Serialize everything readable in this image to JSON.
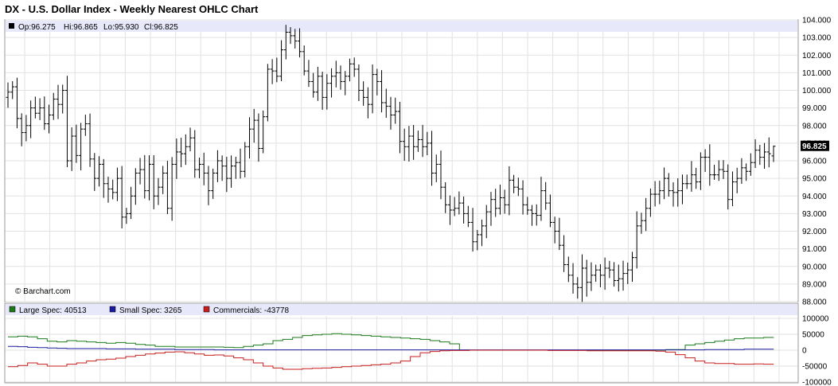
{
  "title": "DX - U.S. Dollar Index - Weekly Nearest OHLC Chart",
  "copyright": "© Barchart.com",
  "colors": {
    "header_band": "#e8e8fb",
    "grid": "#e2e2e2",
    "price": "#000000",
    "large_spec": "#1a7a1a",
    "small_spec": "#1a1aa0",
    "commercials": "#c81e1e",
    "last_box": "#000000"
  },
  "chart_data": [
    {
      "type": "ohlc",
      "header": {
        "open": "Op:96.275",
        "high": "Hi:96.865",
        "low": "Lo:95.930",
        "close": "Cl:96.825"
      },
      "last_value_label": "96.825",
      "ylim": [
        88,
        104
      ],
      "yticks": [
        "88.000",
        "89.000",
        "90.000",
        "91.000",
        "92.000",
        "93.000",
        "94.000",
        "95.000",
        "96.000",
        "97.000",
        "98.000",
        "99.000",
        "100.000",
        "101.000",
        "102.000",
        "103.000",
        "104.000"
      ],
      "grid": true,
      "last": {
        "open": 96.275,
        "high": 96.865,
        "low": 95.93,
        "close": 96.825
      },
      "closes": [
        99.9,
        100.2,
        98.4,
        97.6,
        98.0,
        99.0,
        98.7,
        99.0,
        98.1,
        98.6,
        99.5,
        99.2,
        100.0,
        96.0,
        97.4,
        96.3,
        97.8,
        98.1,
        96.1,
        95.0,
        95.8,
        94.7,
        94.4,
        94.2,
        95.0,
        92.8,
        93.0,
        94.0,
        95.3,
        95.5,
        94.3,
        95.8,
        94.0,
        94.5,
        95.3,
        93.3,
        95.8,
        96.5,
        96.4,
        96.8,
        97.3,
        95.5,
        95.8,
        95.3,
        94.3,
        95.3,
        96.0,
        95.7,
        95.0,
        95.7,
        95.9,
        95.4,
        96.8,
        97.8,
        98.3,
        96.7,
        98.5,
        101.2,
        101.1,
        100.8,
        102.3,
        103.3,
        103.1,
        102.8,
        102.2,
        101.1,
        100.5,
        99.9,
        100.8,
        99.6,
        100.4,
        100.8,
        101.0,
        100.5,
        100.8,
        101.5,
        101.2,
        100.0,
        99.6,
        99.2,
        100.9,
        100.5,
        99.3,
        99.1,
        98.6,
        98.8,
        97.1,
        96.8,
        97.4,
        96.8,
        97.2,
        96.8,
        97.0,
        95.3,
        95.8,
        94.5,
        93.5,
        93.2,
        93.3,
        93.6,
        93.0,
        92.5,
        91.4,
        91.8,
        92.3,
        93.1,
        93.8,
        93.3,
        93.9,
        93.5,
        94.9,
        94.5,
        94.4,
        93.5,
        93.2,
        93.0,
        92.9,
        94.3,
        93.6,
        92.5,
        92.0,
        91.2,
        90.1,
        89.5,
        89.0,
        88.8,
        89.9,
        89.1,
        89.5,
        89.8,
        89.5,
        89.9,
        89.8,
        89.2,
        89.3,
        89.6,
        89.8,
        90.5,
        92.3,
        92.6,
        93.3,
        94.1,
        94.1,
        94.3,
        95.0,
        94.3,
        94.2,
        94.3,
        94.7,
        94.7,
        95.2,
        94.8,
        96.2,
        96.2,
        95.2,
        95.2,
        95.5,
        95.4,
        93.8,
        94.8,
        95.0,
        95.6,
        95.4,
        95.9,
        96.6,
        96.2,
        96.5,
        96.4,
        96.8
      ]
    },
    {
      "type": "line",
      "panel": "commitments-of-traders",
      "ylim": [
        -100000,
        100000
      ],
      "yticks": [
        "-100000",
        "-50000",
        "0",
        "50000",
        "100000"
      ],
      "grid": true,
      "series": [
        {
          "name": "Large Spec",
          "legend_label": "Large Spec: 40513",
          "last": 40513,
          "color": "#1a7a1a",
          "values": [
            42000,
            44000,
            42000,
            36000,
            28000,
            26000,
            30000,
            28000,
            26000,
            24000,
            22000,
            24000,
            22000,
            18000,
            16000,
            12000,
            12000,
            10000,
            10000,
            10000,
            10000,
            10000,
            9000,
            8000,
            12000,
            16000,
            20000,
            30000,
            34000,
            40000,
            46000,
            48000,
            50000,
            52000,
            50000,
            48000,
            46000,
            44000,
            42000,
            40000,
            38000,
            36000,
            34000,
            30000,
            26000,
            20000,
            0,
            0,
            0,
            0,
            0,
            0,
            0,
            0,
            0,
            0,
            0,
            0,
            0,
            0,
            0,
            0,
            0,
            0,
            0,
            0,
            0,
            2000,
            2000,
            16000,
            20000,
            24000,
            28000,
            32000,
            36000,
            38000,
            38000,
            40000,
            40513
          ]
        },
        {
          "name": "Small Spec",
          "legend_label": "Small Spec: 3265",
          "last": 3265,
          "color": "#1a1aa0",
          "values": [
            12000,
            11000,
            9000,
            8000,
            7000,
            6000,
            5000,
            5000,
            5000,
            5000,
            4000,
            4000,
            4000,
            3000,
            3000,
            3000,
            3000,
            2000,
            2000,
            2000,
            2000,
            1000,
            1000,
            1000,
            1000,
            1000,
            1000,
            1000,
            1000,
            1000,
            1000,
            1000,
            1000,
            1000,
            1000,
            1000,
            1000,
            1000,
            1000,
            1000,
            1000,
            1000,
            1000,
            1000,
            1000,
            1000,
            1000,
            1000,
            1000,
            1000,
            1000,
            1000,
            1000,
            1000,
            1000,
            1000,
            1000,
            1000,
            1000,
            1000,
            1000,
            1000,
            1000,
            1000,
            1000,
            1000,
            1000,
            1000,
            1000,
            1000,
            1000,
            2000,
            2000,
            2000,
            2000,
            3000,
            3000,
            3000,
            3265
          ]
        },
        {
          "name": "Commercials",
          "legend_label": "Commercials: -43778",
          "last": -43778,
          "color": "#c81e1e",
          "values": [
            -52000,
            -48000,
            -40000,
            -44000,
            -50000,
            -50000,
            -44000,
            -40000,
            -34000,
            -30000,
            -28000,
            -25000,
            -20000,
            -16000,
            -12000,
            -9000,
            -6000,
            -5000,
            -8000,
            -12000,
            -16000,
            -15000,
            -18000,
            -24000,
            -30000,
            -40000,
            -50000,
            -56000,
            -60000,
            -60000,
            -58000,
            -57000,
            -56000,
            -54000,
            -52000,
            -50000,
            -48000,
            -46000,
            -44000,
            -40000,
            -34000,
            -20000,
            -8000,
            -4000,
            -2000,
            -1000,
            -1000,
            0,
            0,
            0,
            0,
            0,
            0,
            0,
            0,
            -1000,
            -1000,
            -1000,
            -1000,
            -2000,
            -2000,
            -2000,
            -2000,
            -2000,
            -2000,
            -2000,
            -3000,
            -6000,
            -14000,
            -24000,
            -34000,
            -40000,
            -42000,
            -42000,
            -44000,
            -44000,
            -43000,
            -44000,
            -43778
          ]
        }
      ]
    }
  ]
}
